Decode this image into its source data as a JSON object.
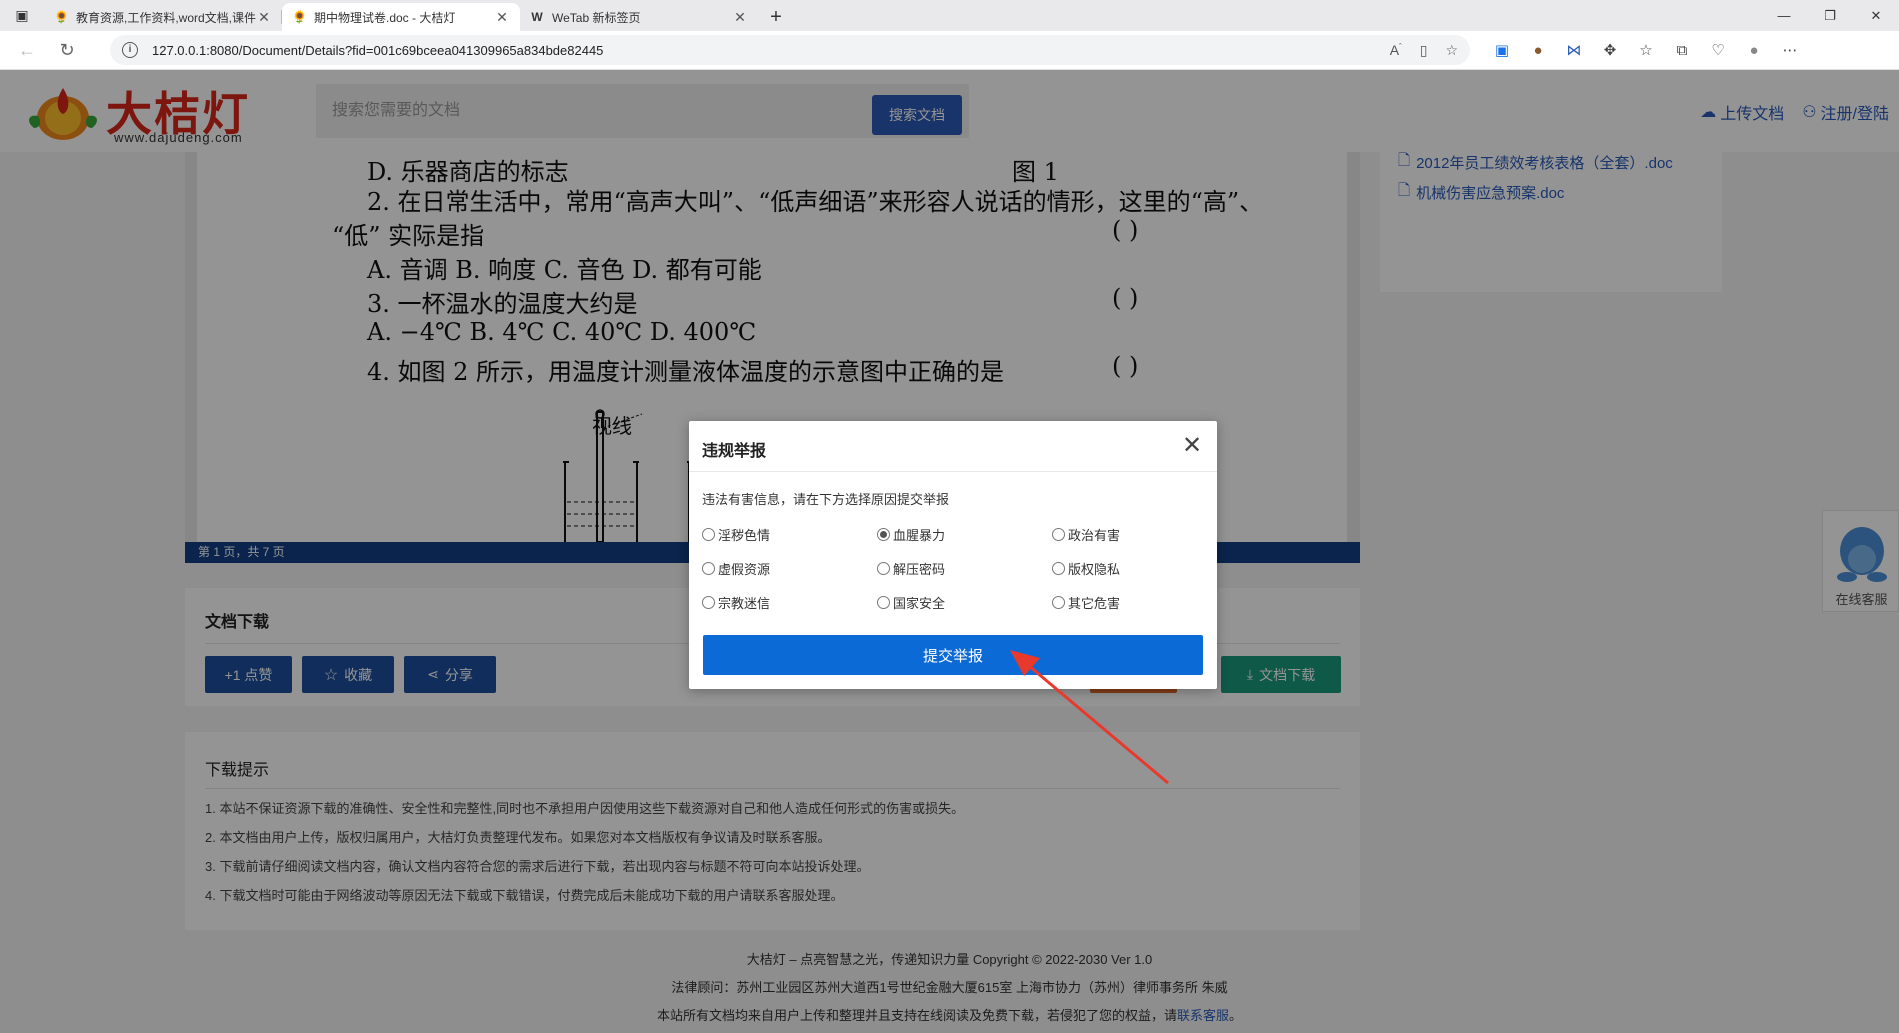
{
  "browser": {
    "tabs": [
      {
        "title": "教育资源,工作资料,word文档,课件",
        "icon": "🌻"
      },
      {
        "title": "期中物理试卷.doc - 大桔灯",
        "icon": "🌻"
      },
      {
        "title": "WeTab 新标签页",
        "icon": "W"
      }
    ],
    "url": "127.0.0.1:8080/Document/Details?fid=001c69bceea041309965a834bde82445"
  },
  "header": {
    "logo_text": "大桔灯",
    "logo_sub": "www.dajudeng.com",
    "search_placeholder": "搜索您需要的文档",
    "search_button": "搜索文档",
    "upload_link": "上传文档",
    "login_link": "注册/登陆"
  },
  "document": {
    "lines": [
      "D. 乐器商店的标志",
      "图  1",
      "2. 在日常生活中，常用“高声大叫”、“低声细语”来形容人说话的情形，这里的“高”、",
      "“低” 实际是指",
      "(      )",
      "A. 音调        B. 响度        C. 音色        D. 都有可能",
      "3. 一杯温水的温度大约是",
      "(      )",
      "A.  −4℃        B. 4℃        C. 40℃        D. 400℃",
      "4. 如图 2 所示，用温度计测量液体温度的示意图中正确的是",
      "(      )",
      "视线"
    ],
    "page_info": "第 1 页，共 7 页"
  },
  "related_docs": [
    "2012年员工绩效考核表格（全套）.doc",
    "机械伤害应急预案.doc"
  ],
  "download_box": {
    "title": "文档下载",
    "like_button": "+1 点赞",
    "favorite_button": "收藏",
    "share_button": "分享",
    "download_button": "文档下载"
  },
  "tips": {
    "title": "下载提示",
    "items": [
      "1. 本站不保证资源下载的准确性、安全性和完整性,同时也不承担用户因使用这些下载资源对自己和他人造成任何形式的伤害或损失。",
      "2. 本文档由用户上传，版权归属用户，大桔灯负责整理代发布。如果您对本文档版权有争议请及时联系客服。",
      "3. 下载前请仔细阅读文档内容，确认文档内容符合您的需求后进行下载，若出现内容与标题不符可向本站投诉处理。",
      "4. 下载文档时可能由于网络波动等原因无法下载或下载错误，付费完成后未能成功下载的用户请联系客服处理。"
    ]
  },
  "footer": {
    "line1": "大桔灯 – 点亮智慧之光，传递知识力量 Copyright © 2022-2030 Ver 1.0",
    "line2": "法律顾问：苏州工业园区苏州大道西1号世纪金融大厦615室 上海市协力（苏州）律师事务所 朱威",
    "line3_prefix": "本站所有文档均来自用户上传和整理并且支持在线阅读及免费下载，若侵犯了您的权益，请",
    "line3_link": "联系客服",
    "line3_suffix": "。"
  },
  "online_service": "在线客服",
  "report_modal": {
    "title": "违规举报",
    "description": "违法有害信息，请在下方选择原因提交举报",
    "reasons": [
      {
        "label": "淫秽色情",
        "checked": false
      },
      {
        "label": "血腥暴力",
        "checked": true
      },
      {
        "label": "政治有害",
        "checked": false
      },
      {
        "label": "虚假资源",
        "checked": false
      },
      {
        "label": "解压密码",
        "checked": false
      },
      {
        "label": "版权隐私",
        "checked": false
      },
      {
        "label": "宗教迷信",
        "checked": false
      },
      {
        "label": "国家安全",
        "checked": false
      },
      {
        "label": "其它危害",
        "checked": false
      }
    ],
    "submit_button": "提交举报"
  },
  "colors": {
    "brand_blue": "#2a5ab8",
    "submit_blue": "#0c6ad6",
    "doc_bar": "#123f86",
    "download_green": "#1a9a7e",
    "logo_red": "#d8261a",
    "arrow_red": "#e8392c"
  }
}
